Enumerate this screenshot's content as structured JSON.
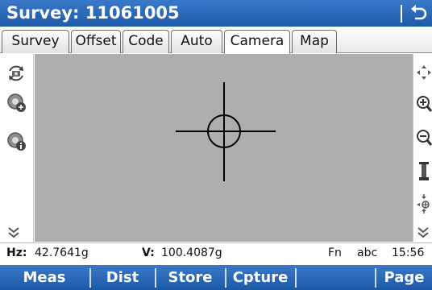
{
  "title": "Survey: 11061005",
  "tabs": [
    {
      "label": "Survey",
      "active": false
    },
    {
      "label": "Offset",
      "active": false
    },
    {
      "label": "Code",
      "active": false
    },
    {
      "label": "Auto",
      "active": false
    },
    {
      "label": "Camera",
      "active": true
    },
    {
      "label": "Map",
      "active": false
    }
  ],
  "left_toolbar": [
    "camera-switch-icon",
    "camera-settings-icon",
    "camera-info-icon",
    "scroll-down-icon"
  ],
  "right_toolbar": [
    "pan-icon",
    "zoom-in-icon",
    "zoom-out-icon",
    "height-icon",
    "center-target-icon",
    "scroll-down-icon"
  ],
  "status": {
    "hz_label": "Hz:",
    "hz_value": "42.7641g",
    "v_label": "V:",
    "v_value": "100.4087g",
    "fn": "Fn",
    "input_mode": "abc",
    "time": "15:56"
  },
  "softkeys": [
    "Meas",
    "Dist",
    "Store",
    "Cpture",
    "",
    "Page"
  ],
  "colors": {
    "title_bar": "#1d5aa9",
    "viewport": "#aeaeae",
    "accent": "#2a6cc0"
  }
}
